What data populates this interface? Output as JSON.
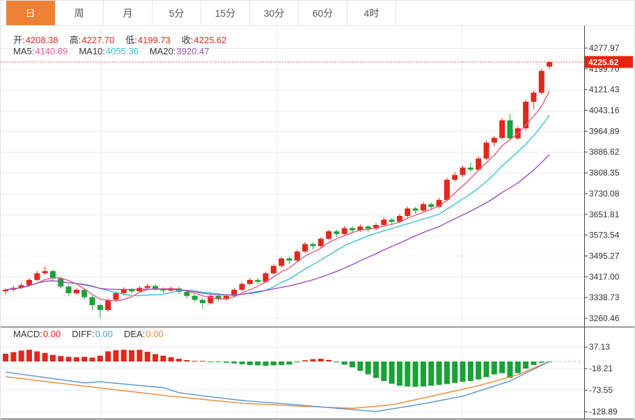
{
  "tabs": {
    "items": [
      {
        "label": "日",
        "active": true
      },
      {
        "label": "周",
        "active": false
      },
      {
        "label": "月",
        "active": false
      },
      {
        "label": "5分",
        "active": false
      },
      {
        "label": "15分",
        "active": false
      },
      {
        "label": "30分",
        "active": false
      },
      {
        "label": "60分",
        "active": false
      },
      {
        "label": "4时",
        "active": false
      }
    ]
  },
  "ohlc_bar": {
    "open_label": "开:",
    "open": "4208.38",
    "high_label": "高:",
    "high": "4227.70",
    "low_label": "低:",
    "low": "4199.73",
    "close_label": "收:",
    "close": "4225.62"
  },
  "ma_bar": {
    "ma5_label": "MA5:",
    "ma5_value": "4140.89",
    "ma10_label": "MA10:",
    "ma10_value": "4055.36",
    "ma20_label": "MA20:",
    "ma20_value": "3920.47"
  },
  "macd_bar": {
    "macd_label": "MACD:",
    "macd_value": "0.00",
    "diff_label": "DIFF:",
    "diff_value": "0.00",
    "dea_label": "DEA:",
    "dea_value": "0.00"
  },
  "price_badge": "4225.62",
  "colors": {
    "up": "#e2271c",
    "down": "#17a335",
    "ma5": "#ea5a87",
    "ma10": "#35c3d5",
    "ma20": "#9c4fc0",
    "diff": "#5596d2",
    "dea": "#ee8633",
    "tab_accent": "#ef8136",
    "badge": "#e8240c",
    "dotted_price": "#f05555",
    "grid": "#ececec",
    "frame": "#444444",
    "axis_text": "#333333"
  },
  "chart_data": {
    "type": "candlestick",
    "title": "",
    "main": {
      "y_ticks": [
        "4277.97",
        "4199.70",
        "4121.43",
        "4043.16",
        "3964.89",
        "3886.62",
        "3808.35",
        "3730.08",
        "3651.81",
        "3573.54",
        "3495.27",
        "3417.00",
        "3338.73",
        "3260.46"
      ],
      "current_price": 4225.62,
      "ma_periods": [
        5,
        10,
        20
      ],
      "candles": [
        [
          3362,
          3374,
          3352,
          3368
        ],
        [
          3368,
          3382,
          3362,
          3375
        ],
        [
          3375,
          3392,
          3370,
          3385
        ],
        [
          3385,
          3412,
          3380,
          3405
        ],
        [
          3405,
          3438,
          3400,
          3430
        ],
        [
          3430,
          3455,
          3424,
          3438
        ],
        [
          3438,
          3444,
          3400,
          3410
        ],
        [
          3410,
          3416,
          3372,
          3380
        ],
        [
          3380,
          3386,
          3346,
          3355
        ],
        [
          3355,
          3374,
          3350,
          3368
        ],
        [
          3368,
          3372,
          3332,
          3340
        ],
        [
          3340,
          3346,
          3290,
          3310
        ],
        [
          3310,
          3316,
          3262,
          3292
        ],
        [
          3292,
          3336,
          3286,
          3330
        ],
        [
          3330,
          3362,
          3325,
          3355
        ],
        [
          3355,
          3378,
          3350,
          3370
        ],
        [
          3370,
          3376,
          3354,
          3362
        ],
        [
          3362,
          3381,
          3356,
          3375
        ],
        [
          3375,
          3390,
          3370,
          3382
        ],
        [
          3382,
          3388,
          3364,
          3372
        ],
        [
          3372,
          3378,
          3357,
          3365
        ],
        [
          3365,
          3380,
          3360,
          3373
        ],
        [
          3373,
          3378,
          3352,
          3360
        ],
        [
          3360,
          3366,
          3336,
          3345
        ],
        [
          3345,
          3350,
          3322,
          3330
        ],
        [
          3330,
          3336,
          3295,
          3318
        ],
        [
          3318,
          3350,
          3312,
          3345
        ],
        [
          3345,
          3350,
          3324,
          3332
        ],
        [
          3332,
          3350,
          3326,
          3345
        ],
        [
          3345,
          3374,
          3340,
          3368
        ],
        [
          3368,
          3396,
          3362,
          3390
        ],
        [
          3390,
          3412,
          3384,
          3405
        ],
        [
          3405,
          3412,
          3388,
          3398
        ],
        [
          3398,
          3436,
          3392,
          3430
        ],
        [
          3430,
          3464,
          3424,
          3458
        ],
        [
          3458,
          3492,
          3452,
          3486
        ],
        [
          3486,
          3492,
          3466,
          3478
        ],
        [
          3478,
          3518,
          3472,
          3512
        ],
        [
          3512,
          3548,
          3506,
          3540
        ],
        [
          3540,
          3546,
          3520,
          3532
        ],
        [
          3532,
          3566,
          3526,
          3560
        ],
        [
          3560,
          3594,
          3554,
          3588
        ],
        [
          3588,
          3594,
          3566,
          3578
        ],
        [
          3578,
          3608,
          3572,
          3600
        ],
        [
          3600,
          3606,
          3580,
          3592
        ],
        [
          3592,
          3614,
          3586,
          3606
        ],
        [
          3606,
          3612,
          3586,
          3598
        ],
        [
          3598,
          3620,
          3592,
          3612
        ],
        [
          3612,
          3640,
          3606,
          3632
        ],
        [
          3632,
          3638,
          3612,
          3624
        ],
        [
          3624,
          3654,
          3618,
          3646
        ],
        [
          3646,
          3682,
          3640,
          3674
        ],
        [
          3674,
          3680,
          3654,
          3666
        ],
        [
          3666,
          3698,
          3660,
          3690
        ],
        [
          3690,
          3696,
          3668,
          3680
        ],
        [
          3680,
          3714,
          3674,
          3706
        ],
        [
          3706,
          3790,
          3700,
          3782
        ],
        [
          3782,
          3810,
          3774,
          3800
        ],
        [
          3800,
          3836,
          3792,
          3828
        ],
        [
          3828,
          3848,
          3812,
          3820
        ],
        [
          3820,
          3870,
          3814,
          3862
        ],
        [
          3862,
          3930,
          3855,
          3922
        ],
        [
          3922,
          3948,
          3908,
          3940
        ],
        [
          3940,
          4014,
          3934,
          4006
        ],
        [
          4006,
          4030,
          3930,
          3938
        ],
        [
          3938,
          3984,
          3932,
          3976
        ],
        [
          3976,
          4084,
          3968,
          4076
        ],
        [
          4076,
          4118,
          4048,
          4110
        ],
        [
          4110,
          4200,
          4104,
          4192
        ],
        [
          4208.38,
          4227.7,
          4199.73,
          4225.62
        ]
      ]
    },
    "macd": {
      "y_ticks": [
        "37.13",
        "-18.21",
        "-73.55",
        "-128.89"
      ],
      "histogram": [
        20,
        24,
        28,
        30,
        26,
        22,
        17,
        14,
        12,
        11,
        12,
        10,
        15,
        26,
        29,
        30,
        29,
        30,
        25,
        19,
        15,
        11,
        7,
        3.5,
        1.5,
        0.5,
        -0.5,
        -1.5,
        -3,
        -5,
        -7,
        -9,
        -10,
        -11,
        -10,
        -9,
        -8,
        -2,
        3,
        6,
        7,
        4,
        -2,
        -8,
        -15,
        -24,
        -33,
        -42,
        -50,
        -57,
        -62,
        -64,
        -65,
        -64,
        -62,
        -60,
        -58,
        -55,
        -52,
        -50,
        -46,
        -40,
        -33,
        -30,
        -42,
        -30,
        -18,
        -9,
        -3,
        -0.5
      ],
      "diff": [
        -27,
        -29.8,
        -32.6,
        -35.4,
        -38.2,
        -41,
        -43.8,
        -46.6,
        -49.4,
        -52.2,
        -55,
        -53.5,
        -52,
        -53.9,
        -55.8,
        -57.6,
        -59.5,
        -61.4,
        -63.3,
        -65.1,
        -67,
        -73.5,
        -80,
        -82.7,
        -85.3,
        -88,
        -90.4,
        -92.8,
        -95.2,
        -97.6,
        -100,
        -101.6,
        -103.1,
        -104.7,
        -106.3,
        -107.9,
        -109.4,
        -111,
        -112.8,
        -114.6,
        -116.4,
        -118.2,
        -120,
        -121.6,
        -123.2,
        -124.8,
        -126.4,
        -128,
        -124.8,
        -121.6,
        -118.4,
        -115.2,
        -112,
        -108.2,
        -104.3,
        -100.5,
        -96.7,
        -92.8,
        -89,
        -82.5,
        -76,
        -69.5,
        -63,
        -56.5,
        -50,
        -40,
        -30,
        -20,
        -10,
        0
      ],
      "dea": [
        -39,
        -41.4,
        -43.8,
        -46.3,
        -48.7,
        -51.1,
        -53.5,
        -55.9,
        -58.3,
        -60.8,
        -63.2,
        -65.6,
        -68,
        -70.3,
        -72.7,
        -75,
        -77.3,
        -79.7,
        -82,
        -84.3,
        -86.7,
        -89,
        -91,
        -93,
        -95,
        -97,
        -99,
        -101,
        -103,
        -105,
        -107,
        -108,
        -109,
        -110,
        -111,
        -112,
        -113,
        -114,
        -114.9,
        -115.7,
        -116.6,
        -117.4,
        -118.3,
        -119.1,
        -120,
        -118.2,
        -116.4,
        -114.6,
        -112.8,
        -111,
        -106.6,
        -102.2,
        -97.8,
        -93.4,
        -89,
        -84.5,
        -80,
        -75.5,
        -71,
        -66.5,
        -62,
        -56.4,
        -50.8,
        -45.2,
        -39.6,
        -34,
        -25.5,
        -17,
        -8.5,
        0
      ]
    }
  }
}
